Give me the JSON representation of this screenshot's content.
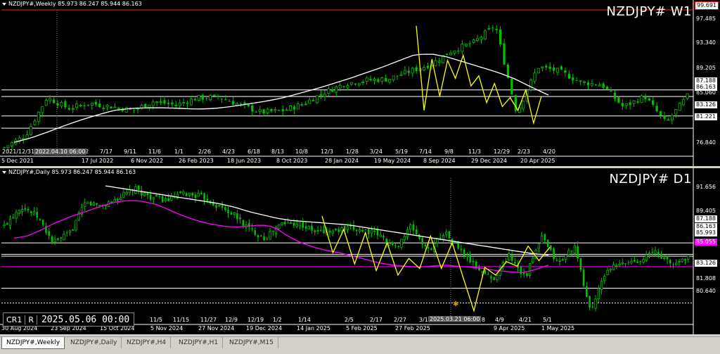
{
  "colors": {
    "background": "#000000",
    "bull": "#00c000",
    "bear": "#00c000",
    "ma_long": "#ffffff",
    "ma_short": "#ff00ff",
    "zigzag": "#ffff00",
    "grid": "#ffffff",
    "magenta_level": "#ff00ff"
  },
  "weekly": {
    "title": "NZDJPY#,Weekly  85.973 86.247 85.944 86.163",
    "symbol": "NZDJPY# W1",
    "price_labels": [
      "99.691",
      "97.485",
      "93.340",
      "89.205",
      "87.188",
      "86.163",
      "85.060",
      "83.126",
      "81.221",
      "76.840"
    ],
    "time_labels": [
      "5 Dec 2021",
      "2021/12/31",
      "2022.04.10 06:00",
      "22",
      "7/17",
      "17 Jul 2022",
      "9/11",
      "11/6",
      "6 Nov 2022",
      "1/1",
      "2/26",
      "26 Feb 2023",
      "4/23",
      "6/18",
      "18 Jun 2023",
      "8/13",
      "10/8",
      "8 Oct 2023",
      "12/3",
      "1/28",
      "28 Jan 2024",
      "3/24",
      "5/19",
      "19 May 2024",
      "7/14",
      "9/8",
      "8 Sep 2024",
      "11/3",
      "12/29",
      "29 Dec 2024",
      "2/23",
      "4/20",
      "20 Apr 2025"
    ],
    "time_box": "2022.04.10 06:00"
  },
  "daily": {
    "title": "NZDJPY#,Daily  85.973 86.247 85.944 86.163",
    "symbol": "NZDJPY# D1",
    "price_labels": [
      "91.656",
      "89.405",
      "87.188",
      "86.163",
      "85.993",
      "85.055",
      "83.126",
      "81.808",
      "80.640"
    ],
    "time_labels": [
      "30 Aug 2024",
      "23 Sep 2024",
      "15 Oct 2024",
      "5 Nov 2024",
      "11/5",
      "11/15",
      "27 Nov 2024",
      "11/27",
      "12/9",
      "12/19",
      "19 Dec 2024",
      "1/2",
      "1/14",
      "14 Jan 2025",
      "2/5",
      "5 Feb 2025",
      "2/17",
      "2/27",
      "27 Feb 2025",
      "3/11",
      "2025.03.21 06:00",
      "3/28",
      "4/9",
      "9 Apr 2025",
      "4/21",
      "5/1",
      "1 May 2025"
    ],
    "time_box": "2025.03.21 06:00",
    "crosshair_cr": "CR1",
    "crosshair_r": "R",
    "crosshair_date": "2025.05.06 00:00"
  },
  "tabs": [
    "NZDJPY#,Weekly",
    "NZDJPY#,Daily",
    "NZDJPY#,H4",
    "NZDJPY#,H1",
    "NZDJPY#,M15"
  ],
  "active_tab": 0,
  "chart_data": [
    {
      "type": "candlestick",
      "title": "NZDJPY# W1",
      "ylim": [
        76.84,
        99.691
      ],
      "x": [
        "5 Dec 2021",
        "17 Jul 2022",
        "6 Nov 2022",
        "26 Feb 2023",
        "18 Jun 2023",
        "8 Oct 2023",
        "28 Jan 2024",
        "19 May 2024",
        "8 Sep 2024",
        "29 Dec 2024",
        "20 Apr 2025"
      ],
      "close_series": [
        78.2,
        80.1,
        86.0,
        84.3,
        85.1,
        84.6,
        84.0,
        85.4,
        84.8,
        85.9,
        86.1,
        84.9,
        83.7,
        83.9,
        85.0,
        86.8,
        88.2,
        88.7,
        88.9,
        90.1,
        91.2,
        93.4,
        94.6,
        97.3,
        83.6,
        90.8,
        90.1,
        88.4,
        88.0,
        84.5,
        86.2,
        82.0,
        86.2
      ],
      "ma_series": [
        79.0,
        79.7,
        80.6,
        81.6,
        82.5,
        83.3,
        84.0,
        84.3,
        84.4,
        84.4,
        84.3,
        84.2,
        84.3,
        84.6,
        85.0,
        85.4,
        85.9,
        86.6,
        87.3,
        88.1,
        88.9,
        89.8,
        90.7,
        91.7,
        92.7,
        92.8,
        92.3,
        91.5,
        90.7,
        89.9,
        88.9,
        87.6,
        86.4
      ],
      "levels": [
        99.691,
        87.188,
        86.163,
        83.126,
        81.221
      ]
    },
    {
      "type": "candlestick",
      "title": "NZDJPY# D1",
      "ylim": [
        80.0,
        93.0
      ],
      "x": [
        "30 Aug 2024",
        "23 Sep 2024",
        "15 Oct 2024",
        "5 Nov 2024",
        "27 Nov 2024",
        "19 Dec 2024",
        "14 Jan 2025",
        "5 Feb 2025",
        "27 Feb 2025",
        "9 Apr 2025",
        "1 May 2025"
      ],
      "close_series": [
        88.7,
        90.5,
        89.6,
        87.2,
        88.0,
        90.8,
        90.5,
        91.2,
        92.0,
        91.3,
        91.0,
        91.6,
        91.4,
        90.6,
        89.8,
        88.5,
        87.6,
        88.9,
        89.0,
        88.2,
        88.2,
        88.4,
        88.4,
        87.9,
        86.7,
        88.7,
        86.4,
        88.2,
        86.5,
        85.0,
        83.9,
        86.1,
        84.1,
        87.7,
        85.3,
        86.9,
        81.0,
        84.8,
        85.3,
        85.7,
        86.4,
        85.2,
        86.0
      ],
      "ma_long_series": [
        92.3,
        92.1,
        91.9,
        91.7,
        91.5,
        91.3,
        91.1,
        90.9,
        90.7,
        90.4,
        90.0,
        89.7,
        89.4,
        89.2,
        89.1,
        89.0,
        88.9,
        88.8,
        88.6,
        88.4,
        88.2,
        88.0,
        87.8,
        87.6,
        87.4,
        87.2,
        87.0,
        86.8,
        86.6,
        86.4,
        86.2,
        86.1
      ],
      "ma_short_series": [
        87.6,
        87.8,
        88.3,
        88.9,
        89.4,
        89.8,
        90.2,
        90.6,
        90.9,
        91.0,
        90.9,
        90.6,
        90.1,
        89.6,
        89.2,
        88.9,
        88.7,
        88.6,
        88.7,
        88.8,
        88.6,
        87.8,
        87.2,
        86.8,
        86.5,
        86.3,
        86.0,
        85.7,
        85.4,
        85.2,
        85.1,
        85.0,
        85.1,
        85.2,
        85.1,
        85.0,
        84.9,
        84.7,
        84.6,
        84.5,
        84.8,
        85.2
      ],
      "levels": [
        87.188,
        86.163,
        85.993,
        85.055,
        83.126,
        81.808
      ]
    }
  ]
}
